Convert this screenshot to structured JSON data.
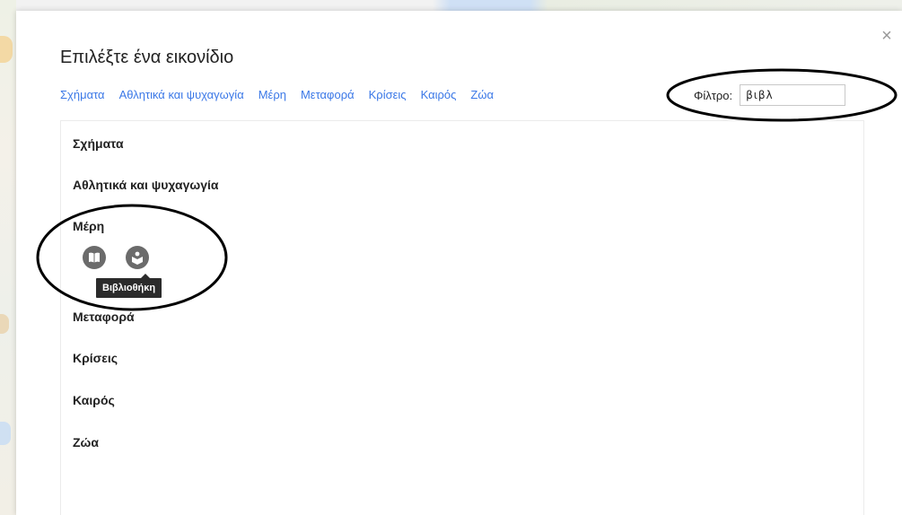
{
  "dialog": {
    "title": "Επιλέξτε ένα εικονίδιο",
    "close_icon": "×",
    "tabs": [
      "Σχήματα",
      "Αθλητικά και ψυχαγωγία",
      "Μέρη",
      "Μεταφορά",
      "Κρίσεις",
      "Καιρός",
      "Ζώα"
    ],
    "filter": {
      "label": "Φίλτρο:",
      "value": "βιβλ"
    }
  },
  "categories": [
    "Σχήματα",
    "Αθλητικά και ψυχαγωγία",
    "Μέρη",
    "Μεταφορά",
    "Κρίσεις",
    "Καιρός",
    "Ζώα"
  ],
  "icons": [
    {
      "name": "book-icon"
    },
    {
      "name": "library-icon"
    }
  ],
  "tooltip": "Βιβλιοθήκη"
}
